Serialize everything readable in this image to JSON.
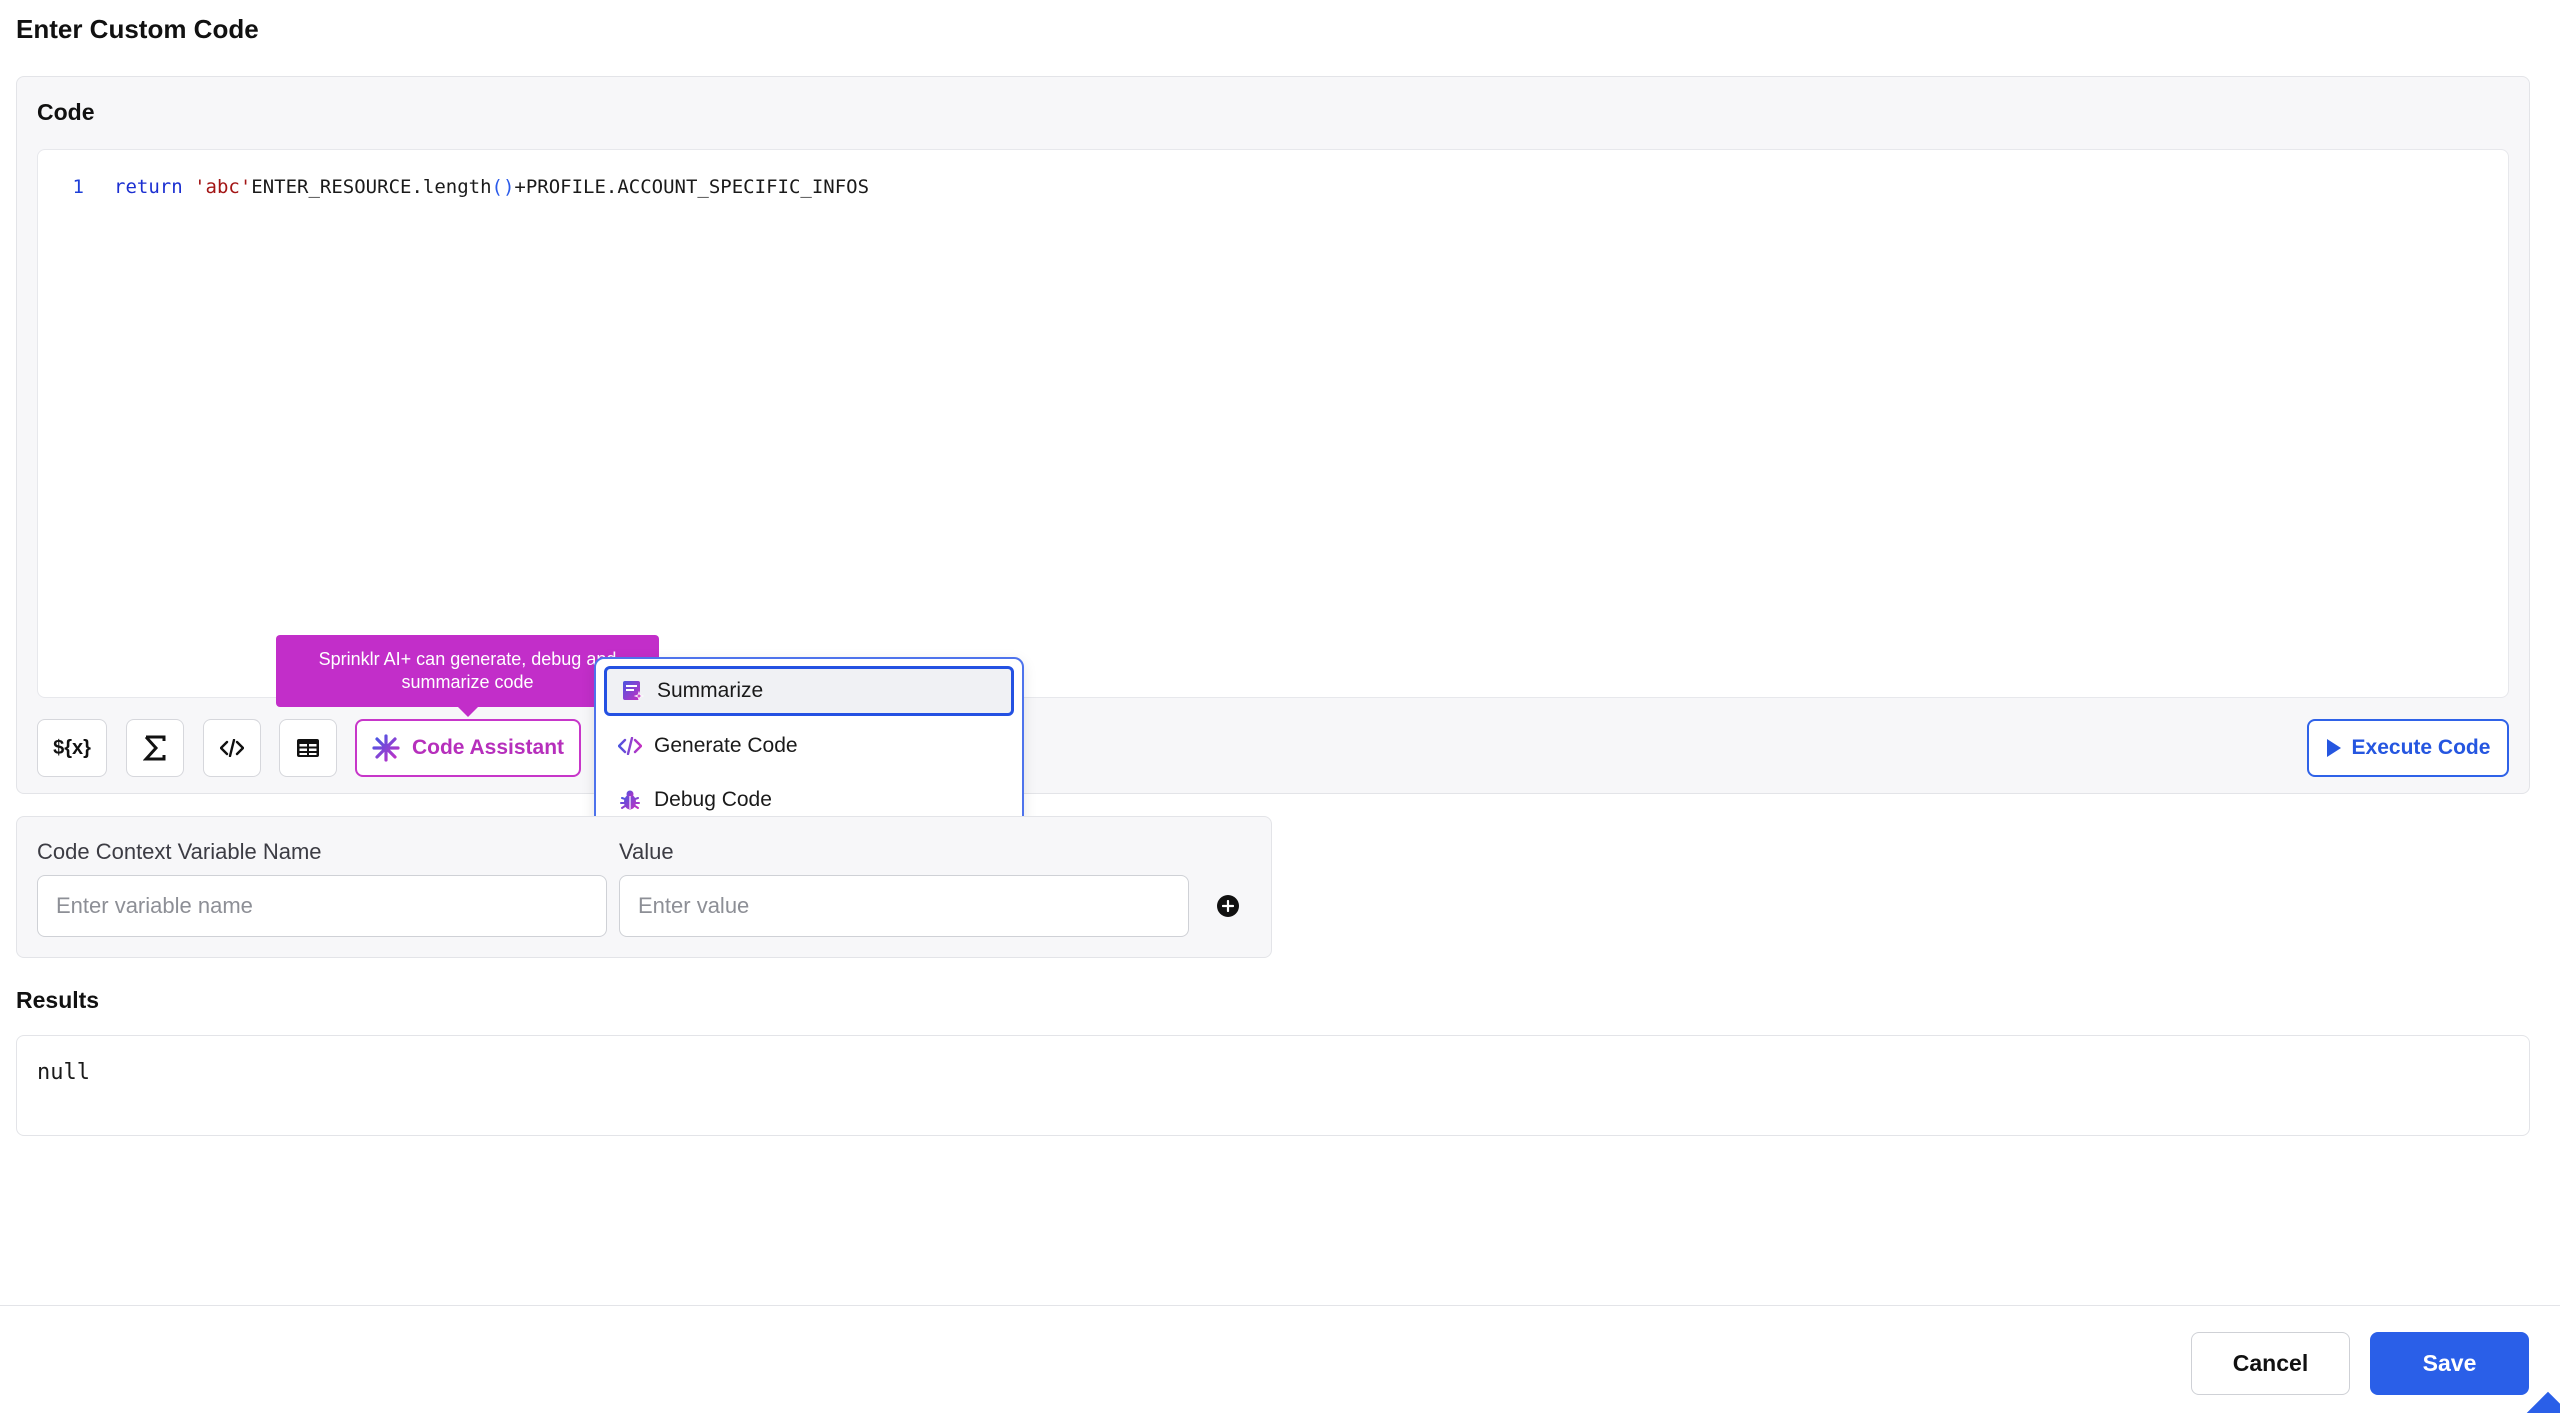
{
  "page": {
    "title": "Enter Custom Code"
  },
  "code_panel": {
    "label": "Code",
    "editor": {
      "line_number": "1",
      "tokens": {
        "keyword": "return",
        "string": "'abc'",
        "ident_before_paren": "ENTER_RESOURCE.length",
        "paren": "()",
        "ident_after_paren": "+PROFILE.ACCOUNT_SPECIFIC_INFOS"
      }
    },
    "toolbar": {
      "variable_button": "${x}",
      "code_assistant_label": "Code Assistant",
      "execute_label": "Execute Code"
    },
    "tooltip": "Sprinklr AI+ can generate, debug and summarize code",
    "dropdown": {
      "items": [
        {
          "label": "Summarize",
          "icon": "summarize-icon",
          "active": true
        },
        {
          "label": "Generate Code",
          "icon": "code-icon",
          "active": false
        },
        {
          "label": "Debug Code",
          "icon": "bug-icon",
          "active": false
        }
      ]
    }
  },
  "context": {
    "name_label": "Code Context Variable Name",
    "name_placeholder": "Enter variable name",
    "value_label": "Value",
    "value_placeholder": "Enter value"
  },
  "results": {
    "label": "Results",
    "value": "null"
  },
  "footer": {
    "cancel_label": "Cancel",
    "save_label": "Save"
  },
  "colors": {
    "accent_blue": "#2a5fe8",
    "ai_magenta": "#c22ec9",
    "panel_bg": "#f7f7f9"
  }
}
